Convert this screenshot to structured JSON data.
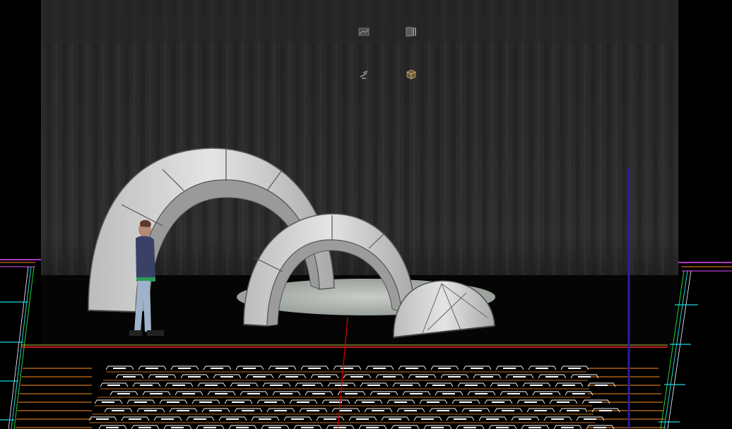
{
  "viewport": {
    "background": "#000000",
    "curtain_color": "#2a2a2a",
    "stage_floor_color": "#050505",
    "arch_color": "#d4d4d4",
    "guide_line_color": "#2a1ea0",
    "axis_red": "#e00000",
    "cad_orange": "#ff8c1a",
    "cad_green": "#2bd12b",
    "cad_cyan": "#19d7e0",
    "cad_magenta": "#e84aff",
    "cad_white": "#ffffff"
  },
  "toolbar": {
    "icons": [
      {
        "name": "render-preview-icon"
      },
      {
        "name": "material-library-icon"
      },
      {
        "name": "light-tool-icon"
      },
      {
        "name": "object-cube-icon"
      }
    ]
  }
}
